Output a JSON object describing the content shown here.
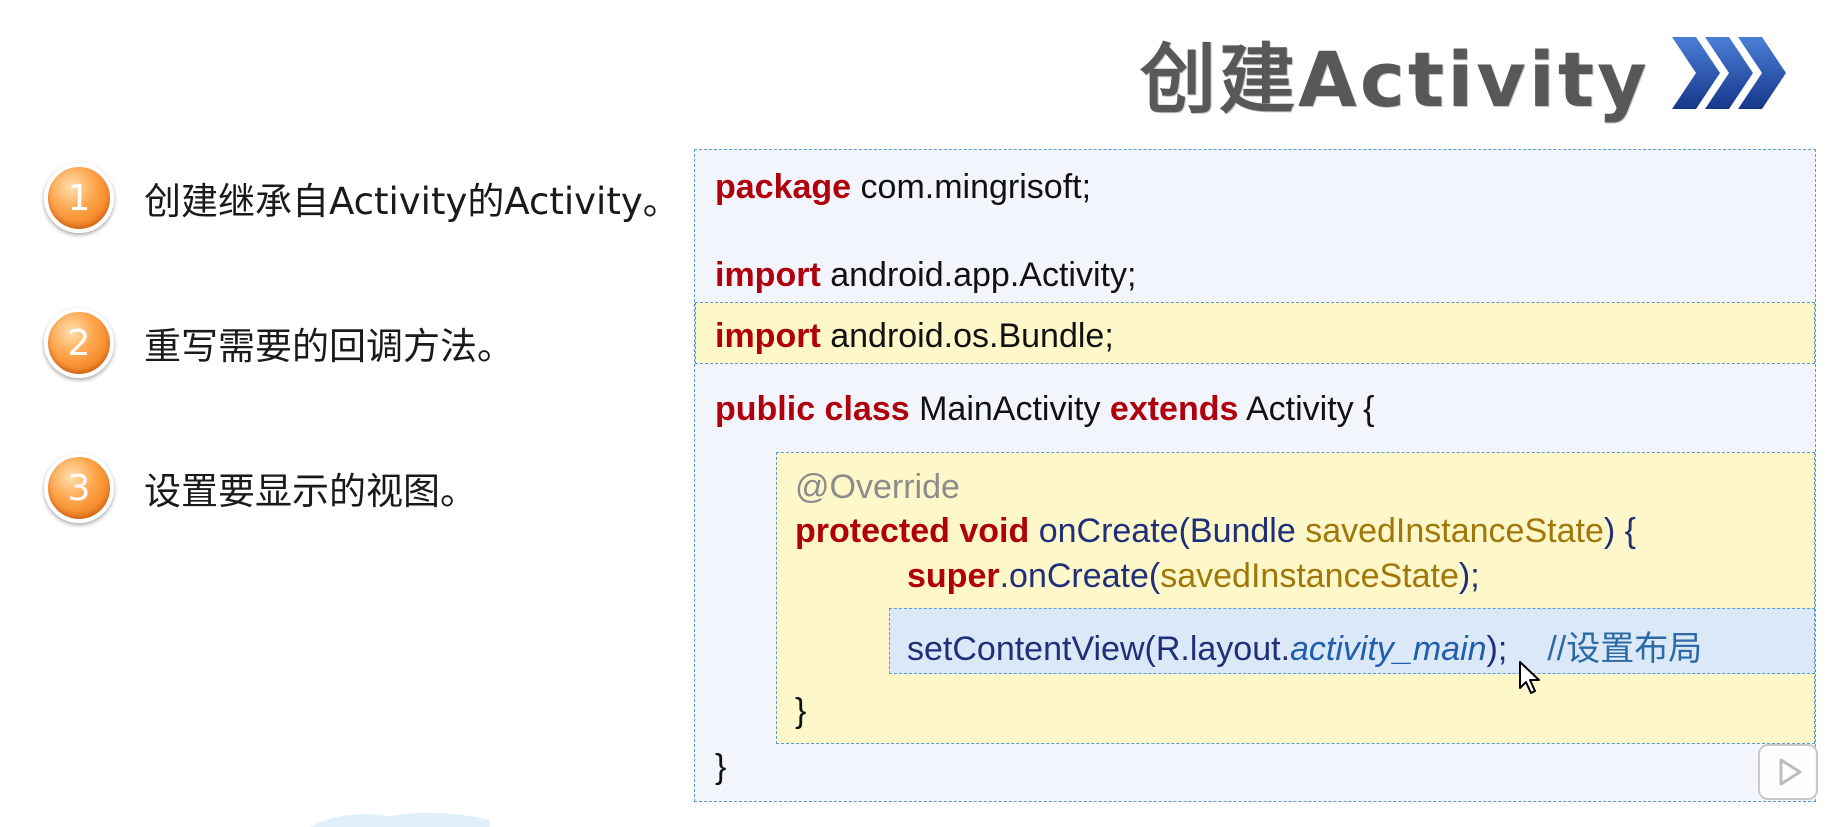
{
  "slide": {
    "title": "创建Activity",
    "steps": [
      {
        "number": "1",
        "text": "创建继承自Activity的Activity。"
      },
      {
        "number": "2",
        "text": "重写需要的回调方法。"
      },
      {
        "number": "3",
        "text": "设置要显示的视图。"
      }
    ]
  },
  "code": {
    "line1": {
      "kw": "package",
      "rest": " com.mingrisoft;"
    },
    "line2": {
      "kw": "import",
      "rest": " android.app.Activity;"
    },
    "line3": {
      "kw": "import",
      "rest": " android.os.Bundle;"
    },
    "line4": {
      "kw": "public class",
      "rest": " MainActivity ",
      "kw2": "extends",
      "rest2": " Activity {"
    },
    "line5": {
      "annotation": "@Override"
    },
    "line6": {
      "kw": "protected void",
      "method": " onCreate(Bundle ",
      "param": "savedInstanceState",
      "end": ") {"
    },
    "line7": {
      "kw": "super",
      "method": ".onCreate(",
      "param": "savedInstanceState",
      "end": ");"
    },
    "line8": {
      "method": "setContentView(R.layout.",
      "field": "activity_main",
      "end": ");",
      "comment": "//设置布局"
    },
    "line9": {
      "text": "}"
    },
    "line10": {
      "text": "}"
    }
  },
  "colors": {
    "keyword": "#b0000c",
    "accent_blue": "#1f5fae",
    "highlight_yellow": "#fdf7c9",
    "badge_orange": "#ffa64d"
  },
  "icons": [
    "chevron-right-icon",
    "mouse-pointer-icon",
    "play-icon"
  ]
}
